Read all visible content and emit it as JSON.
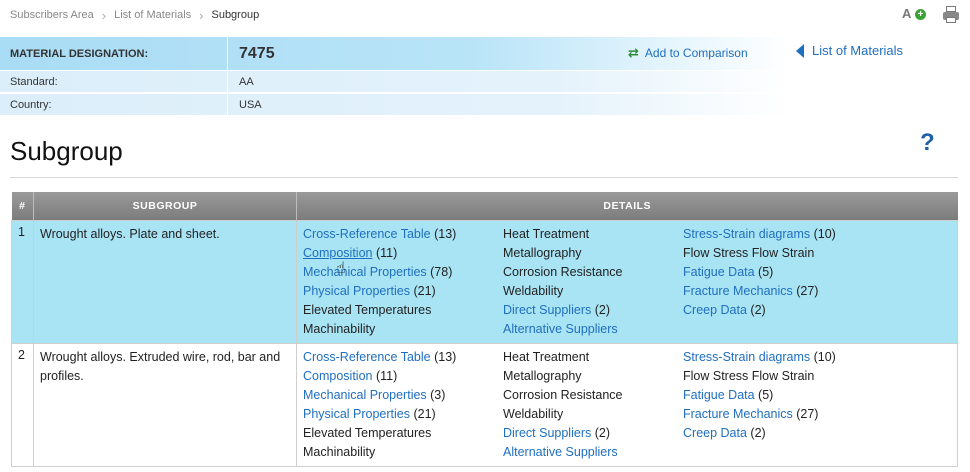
{
  "breadcrumb": {
    "items": [
      "Subscribers Area",
      "List of Materials"
    ],
    "current": "Subgroup"
  },
  "icons": {
    "font": "font-size-plus-icon",
    "print": "print-icon",
    "font_text": "A",
    "font_plus": "+"
  },
  "material": {
    "designation_label": "MATERIAL DESIGNATION:",
    "designation_value": "7475",
    "standard_label": "Standard:",
    "standard_value": "AA",
    "country_label": "Country:",
    "country_value": "USA"
  },
  "actions": {
    "compare_label": "Add to Comparison",
    "compare_icon": "⇄",
    "list_label": "List of Materials"
  },
  "page": {
    "title": "Subgroup",
    "help": "?"
  },
  "table": {
    "headers": {
      "num": "#",
      "subgroup": "SUBGROUP",
      "details": "DETAILS"
    },
    "rows": [
      {
        "num": "1",
        "subgroup": "Wrought alloys. Plate and sheet.",
        "col_a": [
          {
            "label": "Cross-Reference Table",
            "count": " (13)",
            "link": true
          },
          {
            "label": "Composition",
            "count": " (11)",
            "link": true
          },
          {
            "label": "Mechanical Properties",
            "count": " (78)",
            "link": true
          },
          {
            "label": "Physical Properties",
            "count": " (21)",
            "link": true
          },
          {
            "label": "Elevated Temperatures",
            "count": "",
            "link": false
          },
          {
            "label": "Machinability",
            "count": "",
            "link": false
          }
        ],
        "col_b": [
          {
            "label": "Heat Treatment",
            "count": "",
            "link": false
          },
          {
            "label": "Metallography",
            "count": "",
            "link": false
          },
          {
            "label": "Corrosion Resistance",
            "count": "",
            "link": false
          },
          {
            "label": "Weldability",
            "count": "",
            "link": false
          },
          {
            "label": "Direct Suppliers",
            "count": " (2)",
            "link": true
          },
          {
            "label": "Alternative Suppliers",
            "count": "",
            "link": true
          }
        ],
        "col_c": [
          {
            "label": "Stress-Strain diagrams",
            "count": " (10)",
            "link": true
          },
          {
            "label": "Flow Stress Flow Strain",
            "count": "",
            "link": false
          },
          {
            "label": "Fatigue Data",
            "count": " (5)",
            "link": true
          },
          {
            "label": "Fracture Mechanics",
            "count": " (27)",
            "link": true
          },
          {
            "label": "Creep Data",
            "count": " (2)",
            "link": true
          }
        ]
      },
      {
        "num": "2",
        "subgroup": "Wrought alloys. Extruded wire, rod, bar and profiles.",
        "col_a": [
          {
            "label": "Cross-Reference Table",
            "count": " (13)",
            "link": true
          },
          {
            "label": "Composition",
            "count": " (11)",
            "link": true
          },
          {
            "label": "Mechanical Properties",
            "count": " (3)",
            "link": true
          },
          {
            "label": "Physical Properties",
            "count": " (21)",
            "link": true
          },
          {
            "label": "Elevated Temperatures",
            "count": "",
            "link": false
          },
          {
            "label": "Machinability",
            "count": "",
            "link": false
          }
        ],
        "col_b": [
          {
            "label": "Heat Treatment",
            "count": "",
            "link": false
          },
          {
            "label": "Metallography",
            "count": "",
            "link": false
          },
          {
            "label": "Corrosion Resistance",
            "count": "",
            "link": false
          },
          {
            "label": "Weldability",
            "count": "",
            "link": false
          },
          {
            "label": "Direct Suppliers",
            "count": " (2)",
            "link": true
          },
          {
            "label": "Alternative Suppliers",
            "count": "",
            "link": true
          }
        ],
        "col_c": [
          {
            "label": "Stress-Strain diagrams",
            "count": " (10)",
            "link": true
          },
          {
            "label": "Flow Stress Flow Strain",
            "count": "",
            "link": false
          },
          {
            "label": "Fatigue Data",
            "count": " (5)",
            "link": true
          },
          {
            "label": "Fracture Mechanics",
            "count": " (27)",
            "link": true
          },
          {
            "label": "Creep Data",
            "count": " (2)",
            "link": true
          }
        ]
      }
    ]
  },
  "colors": {
    "link": "#1f6fbf",
    "highlight_row": "#a9e4f5",
    "header_band": "#a9dcf5",
    "table_header": "#8a8a8a"
  }
}
